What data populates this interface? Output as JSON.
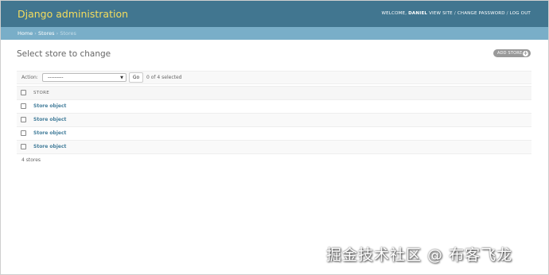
{
  "header": {
    "brand": "Django administration",
    "welcome_prefix": "WELCOME,",
    "username": "DANIEL",
    "view_site": "VIEW SITE",
    "change_password": "CHANGE PASSWORD",
    "log_out": "LOG OUT",
    "separator": "/"
  },
  "breadcrumbs": {
    "home": "Home",
    "stores": "Stores",
    "current": "Stores",
    "separator": "›"
  },
  "main": {
    "title": "Select store to change",
    "add_button": "ADD STORE",
    "add_icon": "plus-icon",
    "action_label": "Action:",
    "action_selected": "---------",
    "go_button": "Go",
    "selected_count": "0 of 4 selected",
    "column_header": "STORE",
    "rows": [
      {
        "label": "Store object"
      },
      {
        "label": "Store object"
      },
      {
        "label": "Store object"
      },
      {
        "label": "Store object"
      }
    ],
    "paginator": "4 stores"
  },
  "watermark": "掘金技术社区 @ 布客飞龙",
  "colors": {
    "header_bg": "#417690",
    "brand_text": "#f5dd5d",
    "breadcrumbs_bg": "#79aec8",
    "link": "#447e9b",
    "add_button_bg": "#999999"
  }
}
